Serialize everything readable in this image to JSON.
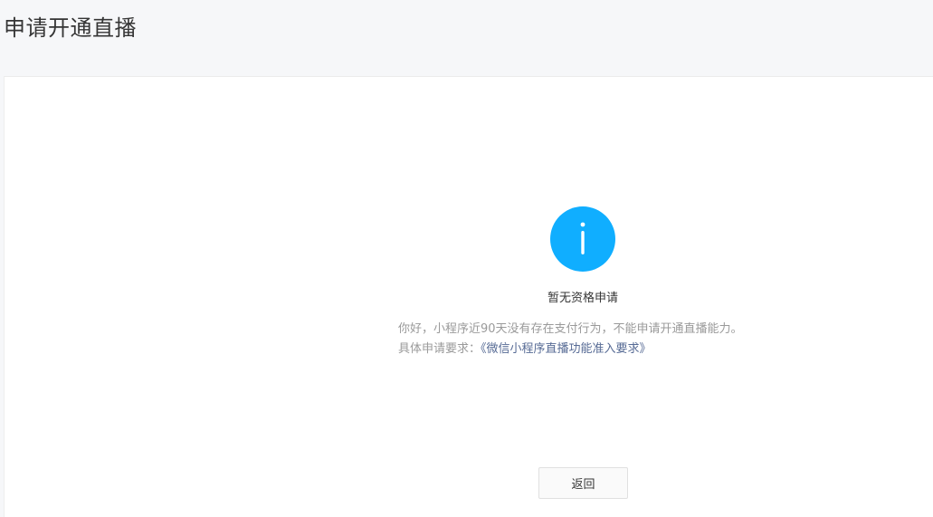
{
  "header": {
    "title": "申请开通直播"
  },
  "status": {
    "icon": "info-icon",
    "icon_color": "#10aeff",
    "title": "暂无资格申请",
    "message": "你好，小程序近90天没有存在支付行为，不能申请开通直播能力。",
    "requirement_prefix": "具体申请要求：",
    "requirement_link": "《微信小程序直播功能准入要求》",
    "link_color": "#576b95"
  },
  "actions": {
    "back_label": "返回"
  }
}
